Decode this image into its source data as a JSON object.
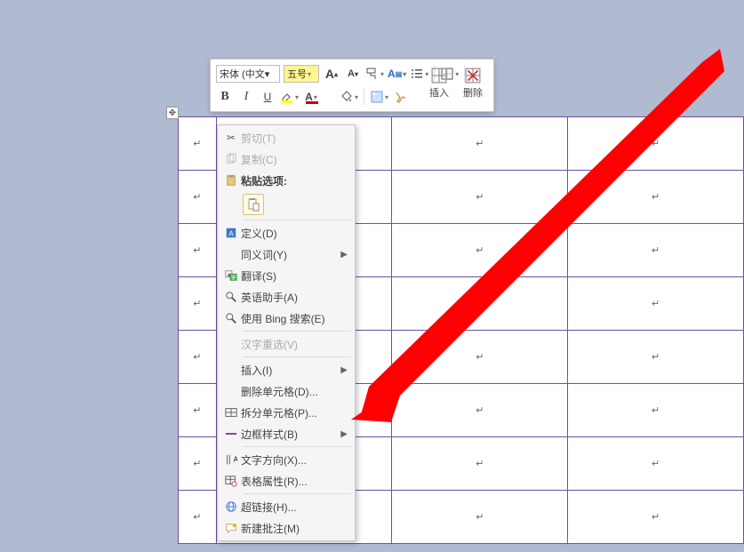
{
  "cell_mark": "↵",
  "move_handle_glyph": "✥",
  "mini_toolbar": {
    "font_name": "宋体 (中文▾",
    "font_size": "五号",
    "increase_font_title": "A",
    "decrease_font_title": "A",
    "insert_label": "插入",
    "delete_label": "删除"
  },
  "context_menu": {
    "cut": "剪切(T)",
    "copy": "复制(C)",
    "paste_header": "粘贴选项:",
    "define": "定义(D)",
    "synonym": "同义词(Y)",
    "translate": "翻译(S)",
    "english_assist": "英语助手(A)",
    "bing_search": "使用 Bing 搜索(E)",
    "reconvert": "汉字重选(V)",
    "insert": "插入(I)",
    "delete_cells": "删除单元格(D)...",
    "split_cells": "拆分单元格(P)...",
    "border_style": "边框样式(B)",
    "text_direction": "文字方向(X)...",
    "table_properties": "表格属性(R)...",
    "hyperlink": "超链接(H)...",
    "new_comment": "新建批注(M)"
  }
}
